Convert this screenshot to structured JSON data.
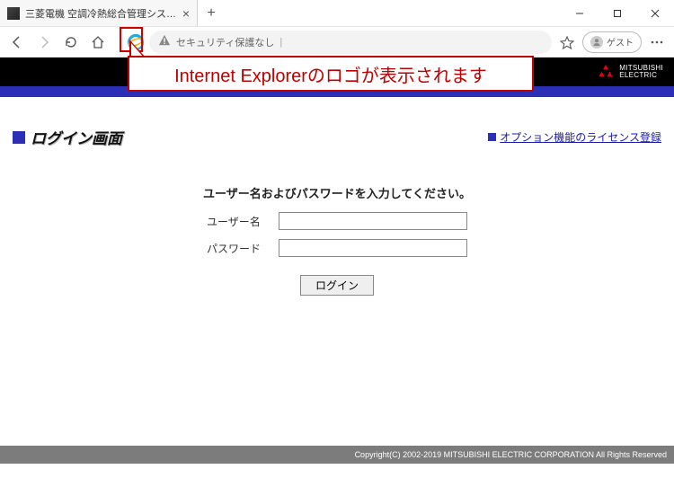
{
  "browser": {
    "tab_title": "三菱電機 空調冷熱総合管理シス…",
    "address_label": "セキュリティ保護なし",
    "guest_label": "ゲスト"
  },
  "page": {
    "brand_line1": "MITSUBISHI",
    "brand_line2": "ELECTRIC",
    "heading": "ログイン画面",
    "license_link": "オプション機能のライセンス登録",
    "login_prompt": "ユーザー名およびパスワードを入力してください。",
    "username_label": "ユーザー名",
    "password_label": "パスワード",
    "login_button": "ログイン",
    "footer": "Copyright(C) 2002-2019 MITSUBISHI ELECTRIC CORPORATION All Rights Reserved"
  },
  "annotation": {
    "callout_text": "Internet Explorerのロゴが表示されます"
  }
}
